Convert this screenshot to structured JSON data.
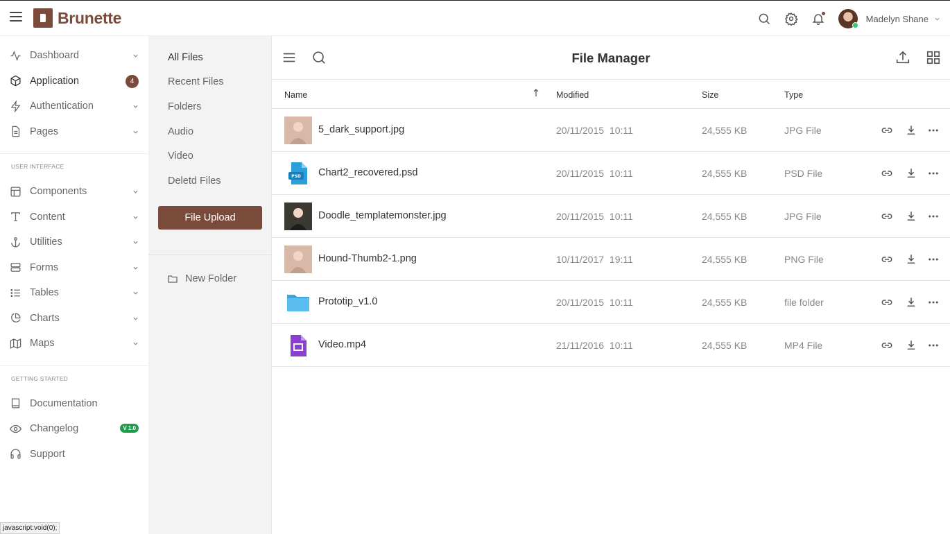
{
  "topbar": {
    "brand": "Brunette",
    "user_name": "Madelyn Shane",
    "icons": [
      "menu-icon",
      "search-icon",
      "gear-icon",
      "bell-icon",
      "chevron-down-icon"
    ]
  },
  "sidebar": {
    "items": [
      {
        "label": "Dashboard",
        "icon": "activity-icon"
      },
      {
        "label": "Application",
        "icon": "box-icon",
        "badge": "4"
      },
      {
        "label": "Authentication",
        "icon": "bolt-icon"
      },
      {
        "label": "Pages",
        "icon": "file-icon"
      }
    ],
    "section_ui": "USER INTERFACE",
    "ui_items": [
      {
        "label": "Components",
        "icon": "layout-icon"
      },
      {
        "label": "Content",
        "icon": "type-icon"
      },
      {
        "label": "Utilities",
        "icon": "anchor-icon"
      },
      {
        "label": "Forms",
        "icon": "server-icon"
      },
      {
        "label": "Tables",
        "icon": "list-icon"
      },
      {
        "label": "Charts",
        "icon": "pie-chart-icon"
      },
      {
        "label": "Maps",
        "icon": "map-icon"
      }
    ],
    "section_start": "GETTING STARTED",
    "start_items": [
      {
        "label": "Documentation",
        "icon": "book-icon"
      },
      {
        "label": "Changelog",
        "icon": "eye-icon",
        "badge": "V 1.0"
      },
      {
        "label": "Support",
        "icon": "headphones-icon"
      }
    ]
  },
  "status_bar": "javascript:void(0);",
  "file_panel": {
    "items": [
      "All Files",
      "Recent Files",
      "Folders",
      "Audio",
      "Video",
      "Deletd Files"
    ],
    "upload_label": "File Upload",
    "new_folder_label": "New Folder"
  },
  "main": {
    "title": "File Manager",
    "columns": {
      "name": "Name",
      "modified": "Modified",
      "size": "Size",
      "type": "Type"
    },
    "files": [
      {
        "name": "5_dark_support.jpg",
        "modified": "20/11/2015 10:11",
        "size": "24,555 KB",
        "type": "JPG File",
        "thumb": "photo"
      },
      {
        "name": "Chart2_recovered.psd",
        "modified": "20/11/2015 10:11",
        "size": "24,555 KB",
        "type": "PSD File",
        "thumb": "psd"
      },
      {
        "name": "Doodle_templatemonster.jpg",
        "modified": "20/11/2015 10:11",
        "size": "24,555 KB",
        "type": "JPG File",
        "thumb": "photo"
      },
      {
        "name": "Hound-Thumb2-1.png",
        "modified": "10/11/2017 19:11",
        "size": "24,555 KB",
        "type": "PNG File",
        "thumb": "photo"
      },
      {
        "name": "Prototip_v1.0",
        "modified": "20/11/2015 10:11",
        "size": "24,555 KB",
        "type": "file folder",
        "thumb": "folder"
      },
      {
        "name": "Video.mp4",
        "modified": "21/11/2016 10:11",
        "size": "24,555 KB",
        "type": "MP4 File",
        "thumb": "video"
      }
    ]
  },
  "colors": {
    "brand": "#7a4a3a",
    "badge_green": "#1e9e4a",
    "panel_bg": "#f3f3f3",
    "folder": "#5bbcf0",
    "psd": "#2b9fd9",
    "video": "#8a3fd1"
  }
}
